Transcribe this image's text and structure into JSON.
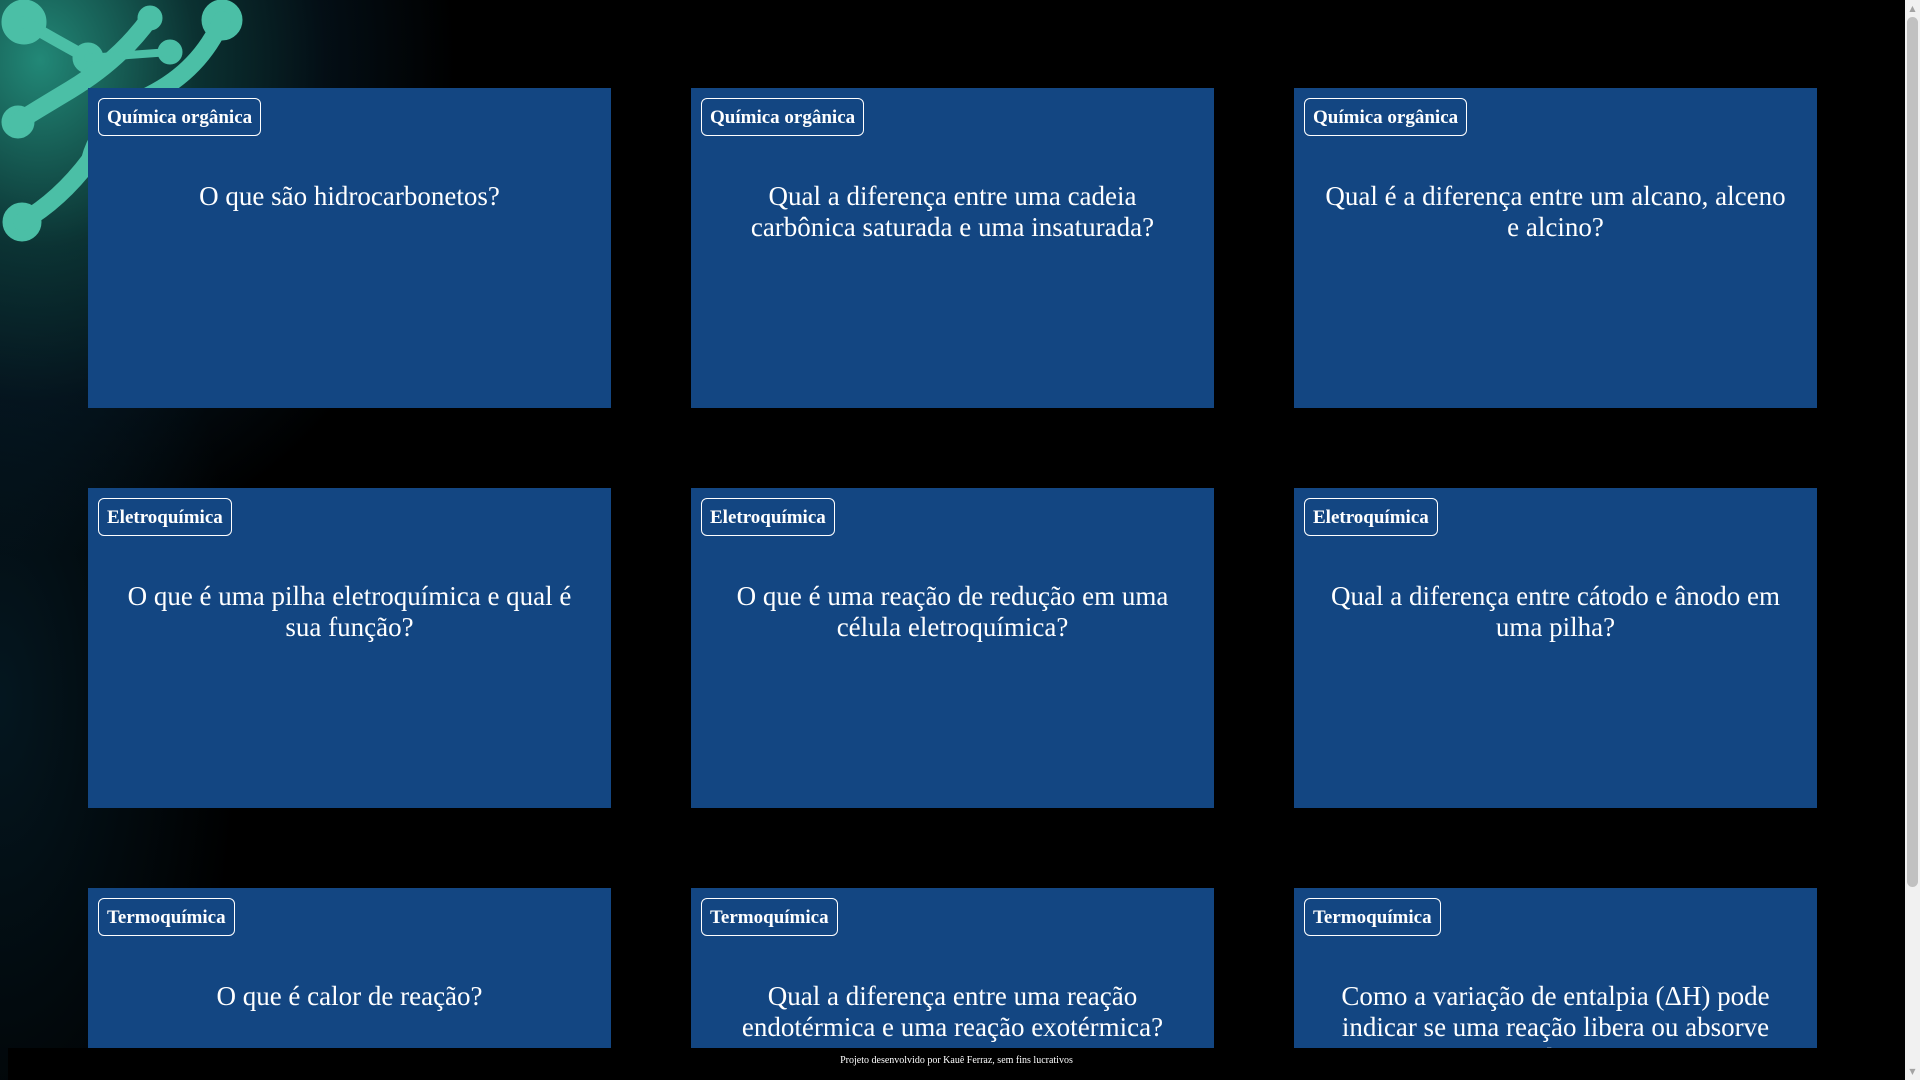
{
  "cards": [
    {
      "tag": "Química orgânica",
      "question": "O que são hidrocarbonetos?"
    },
    {
      "tag": "Química orgânica",
      "question": "Qual a diferença entre uma cadeia carbônica saturada e uma insaturada?"
    },
    {
      "tag": "Química orgânica",
      "question": "Qual é a diferença entre um alcano, alceno e alcino?"
    },
    {
      "tag": "Eletroquímica",
      "question": "O que é uma pilha eletroquímica e qual é sua função?"
    },
    {
      "tag": "Eletroquímica",
      "question": "O que é uma reação de redução em uma célula eletroquímica?"
    },
    {
      "tag": "Eletroquímica",
      "question": "Qual a diferença entre cátodo e ânodo em uma pilha?"
    },
    {
      "tag": "Termoquímica",
      "question": "O que é calor de reação?"
    },
    {
      "tag": "Termoquímica",
      "question": "Qual a diferença entre uma reação endotérmica e uma reação exotérmica?"
    },
    {
      "tag": "Termoquímica",
      "question": "Como a variação de entalpia (ΔH) pode indicar se uma reação libera ou absorve calor?"
    }
  ],
  "footer": {
    "text": "Projeto desenvolvido por Kauê Ferraz, sem fins lucrativos"
  },
  "colors": {
    "card_background": "#134682",
    "page_background": "#000000",
    "accent_teal": "#4fc3a8"
  }
}
